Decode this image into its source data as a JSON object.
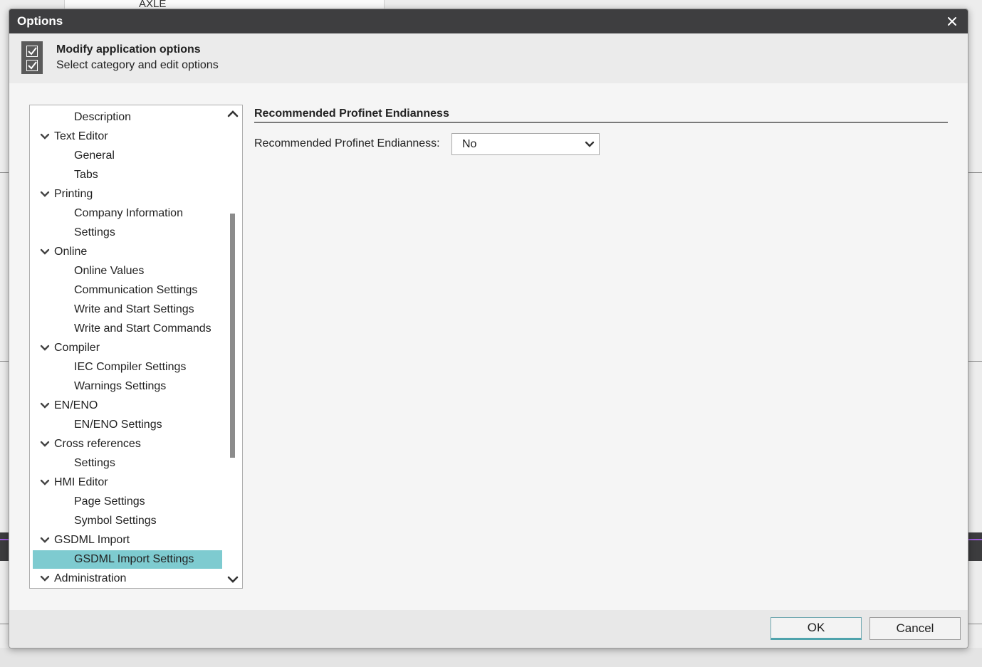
{
  "background": {
    "panel_text": "AXLE"
  },
  "dialog": {
    "title": "Options",
    "header": {
      "title": "Modify application options",
      "subtitle": "Select category and edit options"
    },
    "tree": {
      "items": [
        {
          "label": "Description",
          "kind": "leaf"
        },
        {
          "label": "Text Editor",
          "kind": "category"
        },
        {
          "label": "General",
          "kind": "leaf"
        },
        {
          "label": "Tabs",
          "kind": "leaf"
        },
        {
          "label": "Printing",
          "kind": "category"
        },
        {
          "label": "Company Information",
          "kind": "leaf"
        },
        {
          "label": "Settings",
          "kind": "leaf"
        },
        {
          "label": "Online",
          "kind": "category"
        },
        {
          "label": "Online Values",
          "kind": "leaf"
        },
        {
          "label": "Communication Settings",
          "kind": "leaf"
        },
        {
          "label": "Write and Start Settings",
          "kind": "leaf"
        },
        {
          "label": "Write and Start Commands",
          "kind": "leaf"
        },
        {
          "label": "Compiler",
          "kind": "category"
        },
        {
          "label": "IEC Compiler Settings",
          "kind": "leaf"
        },
        {
          "label": "Warnings Settings",
          "kind": "leaf"
        },
        {
          "label": "EN/ENO",
          "kind": "category"
        },
        {
          "label": "EN/ENO Settings",
          "kind": "leaf"
        },
        {
          "label": "Cross references",
          "kind": "category"
        },
        {
          "label": "Settings",
          "kind": "leaf"
        },
        {
          "label": "HMI Editor",
          "kind": "category"
        },
        {
          "label": "Page Settings",
          "kind": "leaf"
        },
        {
          "label": "Symbol Settings",
          "kind": "leaf"
        },
        {
          "label": "GSDML Import",
          "kind": "category"
        },
        {
          "label": "GSDML Import Settings",
          "kind": "leaf",
          "selected": true
        },
        {
          "label": "Administration",
          "kind": "category"
        }
      ]
    },
    "panel": {
      "section_title": "Recommended Profinet Endianness",
      "field_label": "Recommended Profinet Endianness:",
      "field_value": "No"
    },
    "buttons": {
      "ok": "OK",
      "cancel": "Cancel"
    },
    "colors": {
      "titlebar": "#3e3e40",
      "selection": "#7ecbd0",
      "ok_accent": "#4fa3ac"
    }
  }
}
